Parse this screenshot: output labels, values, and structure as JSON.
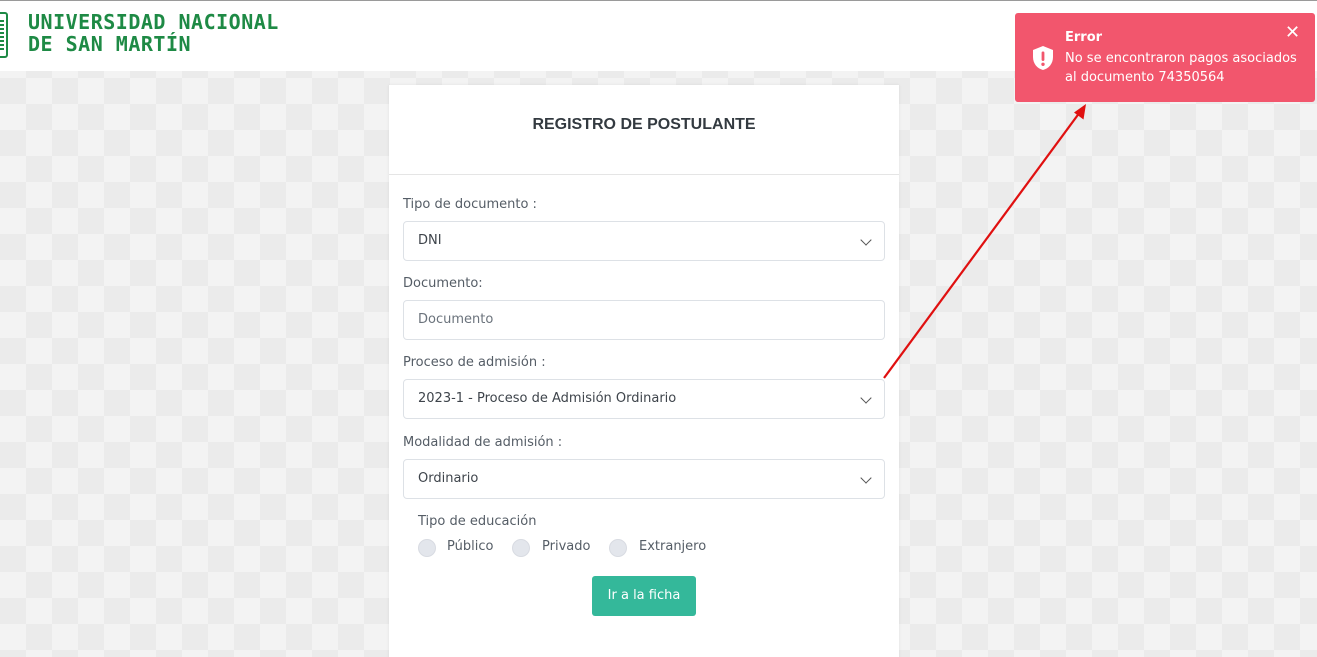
{
  "header": {
    "logo_line1": "UNIVERSIDAD NACIONAL",
    "logo_line2": "DE SAN MARTÍN"
  },
  "form": {
    "title": "REGISTRO DE POSTULANTE",
    "tipo_documento_label": "Tipo de documento :",
    "tipo_documento_value": "DNI",
    "documento_label": "Documento:",
    "documento_placeholder": "Documento",
    "proceso_label": "Proceso de admisión :",
    "proceso_value": "2023-1 - Proceso de Admisión Ordinario",
    "modalidad_label": "Modalidad de admisión :",
    "modalidad_value": "Ordinario",
    "tipo_educacion_label": "Tipo de educación",
    "tipo_educacion_options": [
      "Público",
      "Privado",
      "Extranjero"
    ],
    "submit_label": "Ir a la ficha"
  },
  "toast": {
    "title": "Error",
    "message": "No se encontraron pagos asociados al documento 74350564",
    "close_symbol": "✕"
  },
  "colors": {
    "brand_green": "#1e8a45",
    "button": "#34b89a",
    "toast_bg": "#f2566d",
    "annotation_arrow": "#e01010"
  },
  "icons": [
    "chevron-down-icon",
    "shield-alert-icon",
    "close-icon"
  ]
}
